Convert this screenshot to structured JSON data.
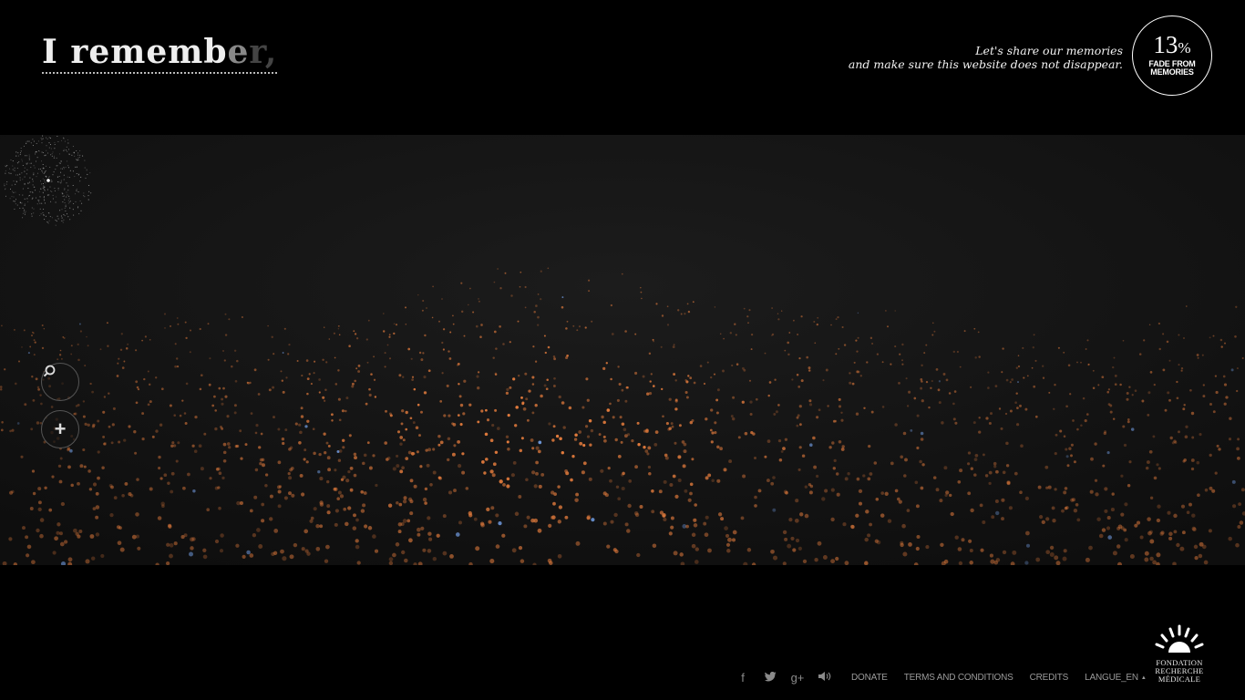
{
  "header": {
    "logo_main": "I rememb",
    "logo_fade1": "e",
    "logo_fade2": "r,",
    "tagline_line1": "Let's share our memories",
    "tagline_line2": "and make sure this website does not disappear.",
    "fade_percent_number": "13",
    "fade_percent_sign": "%",
    "fade_label_line1": "FADE FROM",
    "fade_label_line2": "MEMORIES"
  },
  "tools": {
    "search_icon": "search-icon",
    "add_icon": "plus-icon",
    "add_glyph": "+"
  },
  "footer": {
    "social": [
      {
        "icon": "facebook-icon",
        "glyph": "f"
      },
      {
        "icon": "twitter-icon",
        "glyph": "🐦"
      },
      {
        "icon": "google-plus-icon",
        "glyph": "g+"
      },
      {
        "icon": "speaker-icon",
        "glyph": "🔈"
      }
    ],
    "donate": "DONATE",
    "terms": "TERMS AND CONDITIONS",
    "credits": "CREDITS",
    "language": "LANGUE_EN",
    "language_caret": "▲",
    "sponsor_text": "FONDATION\nRECHERCHE\nMÉDICALE"
  },
  "colors": {
    "background": "#000000",
    "scene_background": "#141414",
    "particle_warm": "#e07a3c",
    "particle_cool": "#7fb0ff"
  }
}
